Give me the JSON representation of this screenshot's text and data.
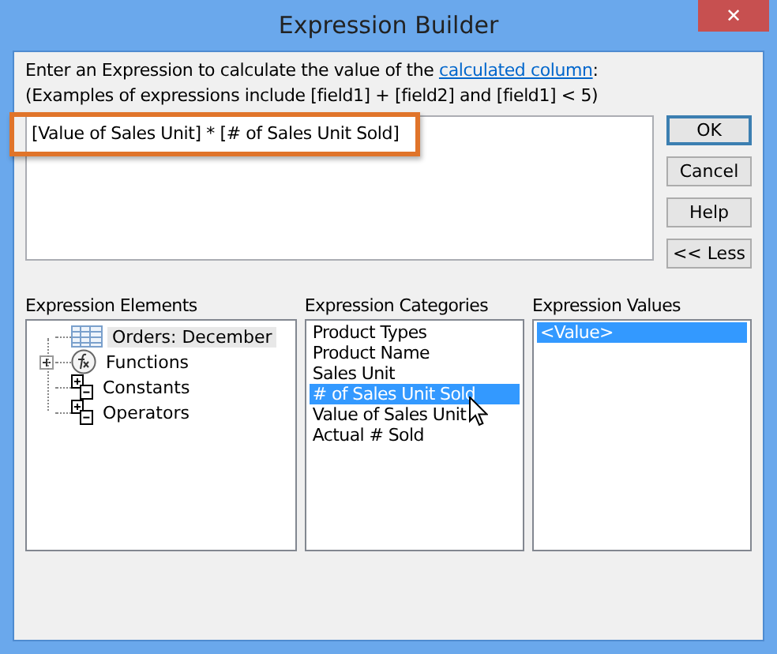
{
  "window": {
    "title": "Expression Builder",
    "close": "✕"
  },
  "prompt": {
    "before": "Enter an Expression to calculate the value of the ",
    "link": "calculated column",
    "after": ":"
  },
  "examples": "(Examples of expressions include [field1] + [field2] and [field1] < 5)",
  "expression": {
    "value": "[Value of Sales Unit] * [# of Sales Unit Sold]",
    "highlighted": true
  },
  "buttons": [
    {
      "label": "OK",
      "default": true
    },
    {
      "label": "Cancel",
      "default": false
    },
    {
      "label": "Help",
      "default": false
    },
    {
      "label": "<< Less",
      "default": false
    }
  ],
  "elements": {
    "title": "Expression Elements",
    "items": [
      {
        "label": "Orders: December",
        "kind": "table",
        "expandable": false,
        "selected": true
      },
      {
        "label": "Functions",
        "kind": "functions",
        "expandable": true,
        "selected": false
      },
      {
        "label": "Constants",
        "kind": "constants",
        "expandable": false,
        "selected": false
      },
      {
        "label": "Operators",
        "kind": "operators",
        "expandable": false,
        "selected": false
      }
    ]
  },
  "categories": {
    "title": "Expression Categories",
    "items": [
      {
        "label": "Product Types",
        "selected": false
      },
      {
        "label": "Product Name",
        "selected": false
      },
      {
        "label": "Sales Unit",
        "selected": false
      },
      {
        "label": "# of Sales Unit Sold",
        "selected": true
      },
      {
        "label": "Value of Sales Unit",
        "selected": false
      },
      {
        "label": "Actual # Sold",
        "selected": false
      }
    ]
  },
  "values": {
    "title": "Expression Values",
    "items": [
      {
        "label": "<Value>",
        "selected": true
      }
    ]
  }
}
